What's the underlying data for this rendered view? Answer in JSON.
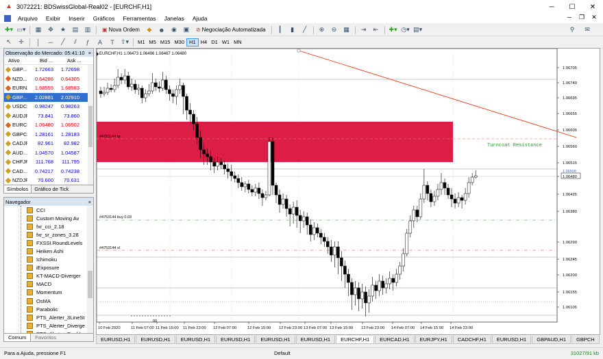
{
  "window": {
    "title": "3072221: BDSwissGlobal-Real02 - [EURCHF,H1]"
  },
  "menu": [
    "Arquivo",
    "Exibir",
    "Inserir",
    "Gráficos",
    "Ferramentas",
    "Janelas",
    "Ajuda"
  ],
  "toolbar": {
    "new_order": "Nova Ordem",
    "auto_trading": "Negociação Automatizada",
    "timeframes": [
      "M1",
      "M5",
      "M15",
      "M30",
      "H1",
      "H4",
      "D1",
      "W1",
      "MN"
    ],
    "active_timeframe": "H1"
  },
  "market_watch": {
    "title": "Observação do Mercado: 05:41:10",
    "headers": [
      "Ativo",
      "Bid ...",
      "Ask ..."
    ],
    "rows": [
      {
        "symbol": "GBP...",
        "bid": "1.72663",
        "ask": "1.72698",
        "color": "blue"
      },
      {
        "symbol": "NZD...",
        "bid": "0.64286",
        "ask": "0.64305",
        "color": "red"
      },
      {
        "symbol": "EURNZD",
        "bid": "1.68555",
        "ask": "1.68583",
        "color": "red"
      },
      {
        "symbol": "GBP...",
        "bid": "2.02881",
        "ask": "2.02910",
        "color": "selected"
      },
      {
        "symbol": "USDCHF",
        "bid": "0.98247",
        "ask": "0.98263",
        "color": "blue"
      },
      {
        "symbol": "AUDJPY",
        "bid": "73.841",
        "ask": "73.860",
        "color": "blue"
      },
      {
        "symbol": "EURCHF",
        "bid": "1.06480",
        "ask": "1.06502",
        "color": "red"
      },
      {
        "symbol": "GBPCHF",
        "bid": "1.28161",
        "ask": "1.28183",
        "color": "blue"
      },
      {
        "symbol": "CADJPY",
        "bid": "82.961",
        "ask": "82.982",
        "color": "blue"
      },
      {
        "symbol": "AUD...",
        "bid": "1.04570",
        "ask": "1.04587",
        "color": "blue"
      },
      {
        "symbol": "CHFJPY",
        "bid": "111.768",
        "ask": "111.795",
        "color": "blue"
      },
      {
        "symbol": "CAD...",
        "bid": "0.74217",
        "ask": "0.74238",
        "color": "blue"
      },
      {
        "symbol": "NZDJPY",
        "bid": "70.600",
        "ask": "70.631",
        "color": "blue"
      }
    ],
    "tabs": [
      "Símbolos",
      "Gráfico de Tick"
    ]
  },
  "navigator": {
    "title": "Navegador",
    "items": [
      "CCI",
      "Custom Moving Av",
      "fxr_cci_2.18",
      "fxr_sr_zones_3.28",
      "FXSSI.RoundLevels",
      "Heiken Ashi",
      "Ichimoku",
      "iExposure",
      "KT-MACD-Diverger",
      "MACD",
      "Momentum",
      "OsMA",
      "Parabolic",
      "PTS_Alerter_3LineSt",
      "PTS_Alerter_Diverge",
      "PTS_Alerter_Double"
    ],
    "tabs": [
      "Comum",
      "Favoritos"
    ]
  },
  "chart": {
    "header": "EURCHF,H1 1.06473 1.06496 1.06467 1.06480",
    "price_labels": [
      "1.06705",
      "1.06740",
      "1.06695",
      "1.06655",
      "1.06605",
      "1.06560",
      "1.06515",
      "1.06480",
      "1.06425",
      "1.06380",
      "1.06290",
      "1.06245",
      "1.06200",
      "1.06155",
      "1.06105"
    ],
    "date_labels": [
      "10 Feb 2020",
      "11 Feb 07:00",
      "11 Feb 15:00",
      "11 Feb 23:00",
      "12 Feb 07:00",
      "12 Feb 15:00",
      "12 Feb 23:00",
      "13 Feb 07:00",
      "13 Feb 15:00",
      "13 Feb 23:00",
      "14 Feb 07:00",
      "14 Feb 15:00",
      "14 Feb 23:00"
    ],
    "labels": {
      "tp": "#4753144 tp",
      "buy": "#4753144 buy 0.03",
      "sl": "#4753144 sl",
      "resistance": "Turncoat Resistance",
      "level": "1.06500",
      "current": "1.06480",
      "small": "00"
    },
    "colors": {
      "zone": "#dc1e46",
      "up": "#ffffff",
      "down": "#000000",
      "trend": "#ff2000"
    }
  },
  "chart_tabs": [
    "EURUSD,H1",
    "EURUSD,H1",
    "EURUSD,H1",
    "EURUSD,H1",
    "EURUSD,H1",
    "EURUSD,H1",
    "EURCHF,H1",
    "EURCAD,H1",
    "EURJPY,H1",
    "CADCHF,H1",
    "EURUSD,H1",
    "GBPAUD,H1",
    "GBPCH"
  ],
  "active_chart_tab": 6,
  "status": {
    "help": "Para a Ajuda, pressione F1",
    "profile": "Default",
    "connection": "31027/91 kb"
  }
}
